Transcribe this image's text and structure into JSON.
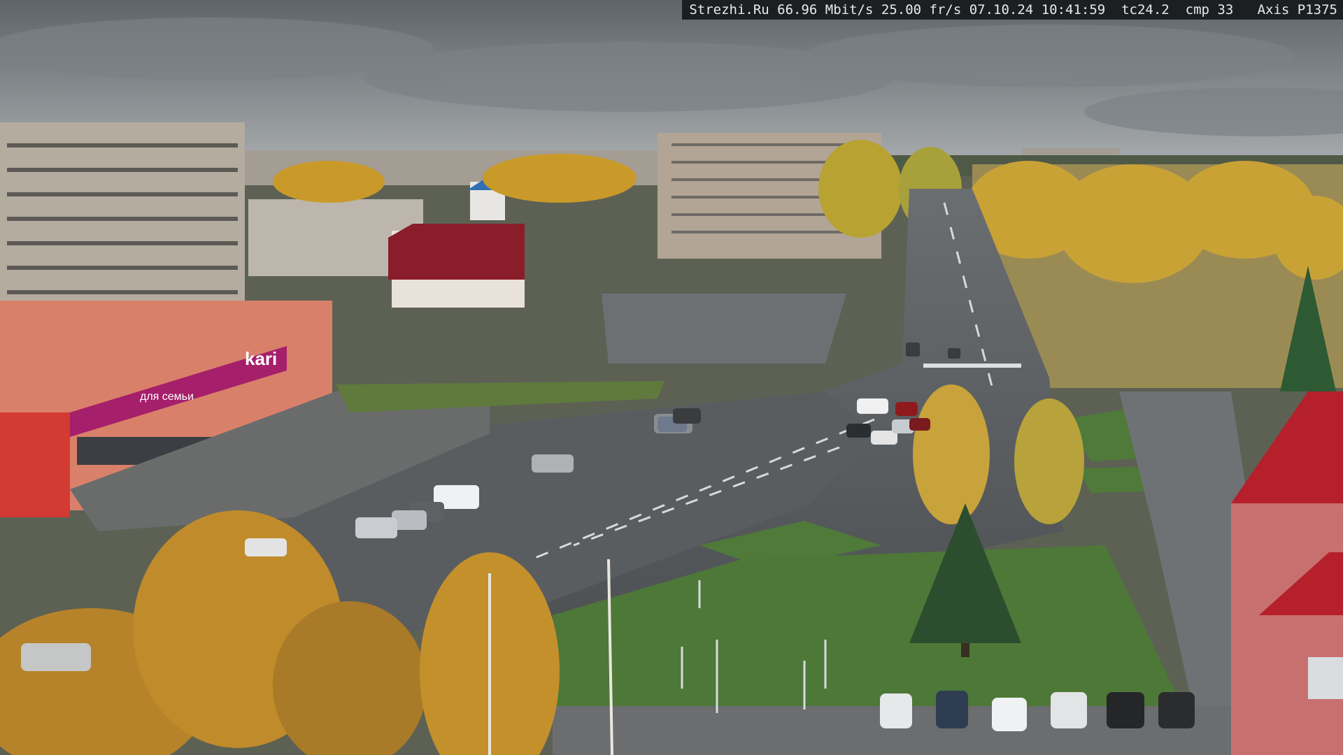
{
  "osd": {
    "site": "Strezhi.Ru",
    "bitrate": "66.96 Mbit/s",
    "framerate": "25.00 fr/s",
    "date": "07.10.24",
    "time": "10:41:59",
    "tc": "tc24.2",
    "cmp": "cmp 33",
    "camera_model": "Axis P1375"
  },
  "signs": {
    "store_brand": "kari",
    "store_slogan": "для семьи"
  },
  "colors": {
    "sky": "#8e9498",
    "road": "#55585b",
    "grass": "#4f7a3a",
    "autumn_foliage": "#c99a2a",
    "kari_banner": "#a51f6a",
    "red_roof": "#b5202b"
  }
}
